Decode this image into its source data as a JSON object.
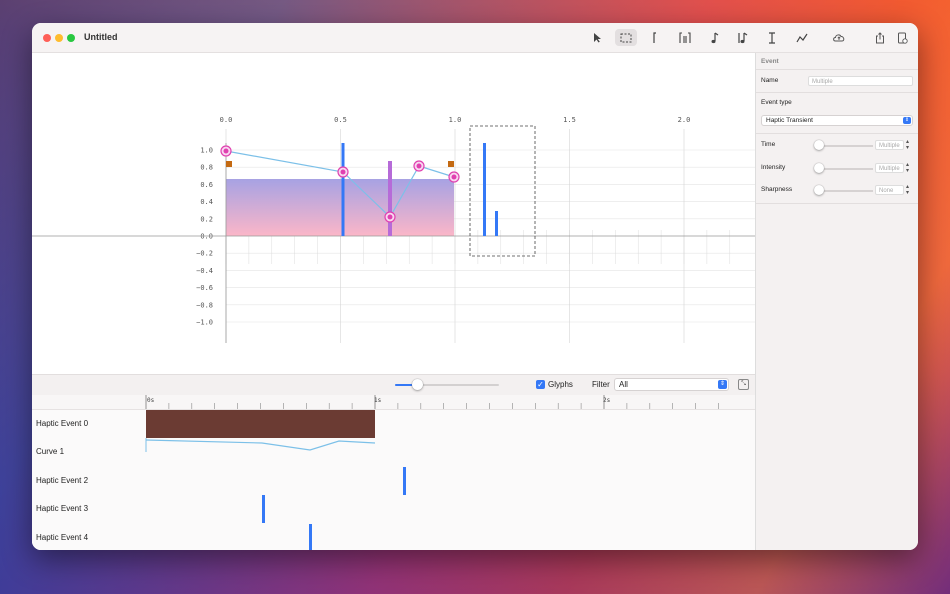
{
  "window": {
    "title": "Untitled"
  },
  "toolbar": {
    "icons": [
      "pointer-icon",
      "marquee-select-icon",
      "bracket-icon",
      "bracket-pair-icon",
      "note-icon",
      "note-bar-icon",
      "text-cursor-icon",
      "curve-icon",
      "cloud-upload-icon",
      "share-icon",
      "inspector-icon"
    ]
  },
  "graph": {
    "x_ticks": [
      "0.0",
      "0.5",
      "1.0",
      "1.5",
      "2.0"
    ],
    "y_ticks": [
      "1.0",
      "0.8",
      "0.6",
      "0.4",
      "0.2",
      "0.0",
      "−0.2",
      "−0.4",
      "−0.6",
      "−0.8",
      "−1.0"
    ]
  },
  "controls": {
    "glyphs_label": "Glyphs",
    "filter_label": "Filter",
    "filter_value": "All",
    "glyphs_checked": true,
    "zoom_level": 0.22
  },
  "ruler": {
    "labels": [
      "0s",
      "1s",
      "2s"
    ]
  },
  "tracks": [
    "Haptic Event 0",
    "Curve 1",
    "Haptic Event 2",
    "Haptic Event 3",
    "Haptic Event 4"
  ],
  "inspector": {
    "section_title": "Event",
    "name_label": "Name",
    "name_placeholder": "Multiple",
    "event_type_label": "Event type",
    "event_type_value": "Haptic Transient",
    "time_label": "Time",
    "time_placeholder": "Multiple",
    "intensity_label": "Intensity",
    "intensity_placeholder": "Multiple",
    "sharpness_label": "Sharpness",
    "sharpness_placeholder": "None"
  },
  "colors": {
    "accent": "#3478f6",
    "continuous_bar": "#6b3b33",
    "curve": "#7cc0e8",
    "handle": "#e040b0",
    "control": "#c46a12"
  }
}
